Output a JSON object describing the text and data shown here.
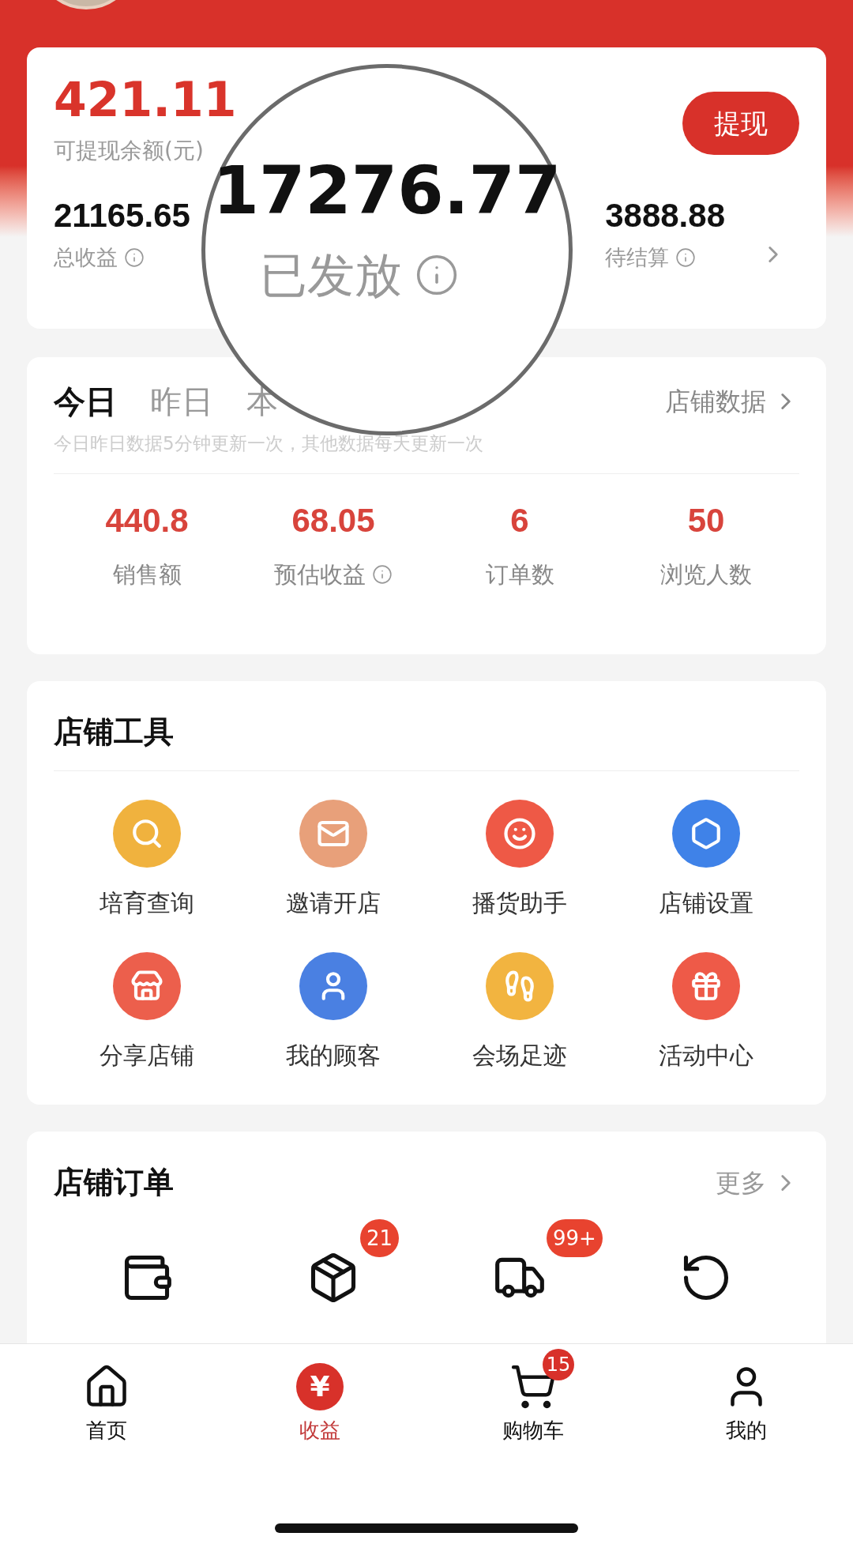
{
  "balance": {
    "amount": "421.11",
    "label": "可提现余额(元)",
    "withdraw_button": "提现"
  },
  "summary": [
    {
      "value": "21165.65",
      "label": "总收益"
    },
    {
      "value": "3888.88",
      "label": "待结算"
    }
  ],
  "magnifier": {
    "value": "17276.77",
    "label": "已发放"
  },
  "stats_card": {
    "tabs": [
      {
        "label": "今日",
        "selected": true
      },
      {
        "label": "昨日",
        "selected": false
      },
      {
        "label": "本",
        "selected": false
      }
    ],
    "link": "店铺数据",
    "note": "今日昨日数据5分钟更新一次，其他数据每天更新一次",
    "metrics": [
      {
        "value": "440.8",
        "label": "销售额",
        "info": false
      },
      {
        "value": "68.05",
        "label": "预估收益",
        "info": true
      },
      {
        "value": "6",
        "label": "订单数",
        "info": false
      },
      {
        "value": "50",
        "label": "浏览人数",
        "info": false
      }
    ]
  },
  "tools": {
    "title": "店铺工具",
    "items": [
      {
        "label": "培育查询",
        "color": "#f0b23e"
      },
      {
        "label": "邀请开店",
        "color": "#e8a07a"
      },
      {
        "label": "播货助手",
        "color": "#ee5946"
      },
      {
        "label": "店铺设置",
        "color": "#3f82e8"
      },
      {
        "label": "分享店铺",
        "color": "#ec5f4c"
      },
      {
        "label": "我的顾客",
        "color": "#4a80e2"
      },
      {
        "label": "会场足迹",
        "color": "#f2b440"
      },
      {
        "label": "活动中心",
        "color": "#ee5a48"
      }
    ]
  },
  "orders": {
    "title": "店铺订单",
    "link": "更多",
    "items": [
      {
        "kind": "wallet"
      },
      {
        "kind": "package",
        "badge": "21"
      },
      {
        "kind": "truck",
        "badge": "99+"
      },
      {
        "kind": "refund"
      }
    ]
  },
  "bottom_nav": [
    {
      "label": "首页",
      "selected": false
    },
    {
      "label": "收益",
      "selected": true,
      "symbol": "¥"
    },
    {
      "label": "购物车",
      "selected": false,
      "badge": "15"
    },
    {
      "label": "我的",
      "selected": false
    }
  ]
}
